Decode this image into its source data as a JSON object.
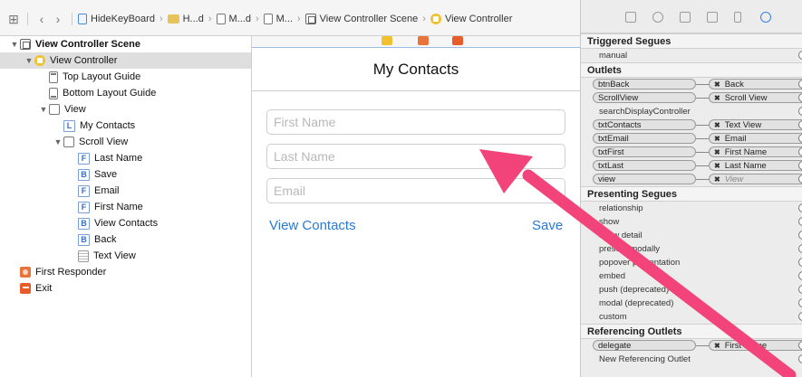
{
  "jumpbar": {
    "breadcrumbs": [
      "HideKeyBoard",
      "H...d",
      "M...d",
      "M...",
      "View Controller Scene",
      "View Controller"
    ]
  },
  "outline": {
    "items": [
      {
        "label": "View Controller Scene",
        "icon": "scene-icon",
        "depth": 0,
        "disclosure": "▼",
        "bold": true
      },
      {
        "label": "View Controller",
        "icon": "view-controller-icon",
        "depth": 1,
        "disclosure": "▼",
        "selected": true
      },
      {
        "label": "Top Layout Guide",
        "icon": "top-layout-guide-icon",
        "depth": 2
      },
      {
        "label": "Bottom Layout Guide",
        "icon": "bottom-layout-guide-icon",
        "depth": 2
      },
      {
        "label": "View",
        "icon": "view-icon",
        "depth": 2,
        "disclosure": "▼"
      },
      {
        "label": "My Contacts",
        "icon": "label-icon",
        "letter": "L",
        "depth": 3
      },
      {
        "label": "Scroll View",
        "icon": "scroll-view-icon",
        "depth": 3,
        "disclosure": "▼"
      },
      {
        "label": "Last Name",
        "icon": "text-field-icon",
        "letter": "F",
        "depth": 4
      },
      {
        "label": "Save",
        "icon": "button-icon",
        "letter": "B",
        "depth": 4
      },
      {
        "label": "Email",
        "icon": "text-field-icon",
        "letter": "F",
        "depth": 4
      },
      {
        "label": "First Name",
        "icon": "text-field-icon",
        "letter": "F",
        "depth": 4
      },
      {
        "label": "View Contacts",
        "icon": "button-icon",
        "letter": "B",
        "depth": 4
      },
      {
        "label": "Back",
        "icon": "button-icon",
        "letter": "B",
        "depth": 4
      },
      {
        "label": "Text View",
        "icon": "text-view-icon",
        "depth": 4
      },
      {
        "label": "First Responder",
        "icon": "first-responder-icon",
        "depth": 0
      },
      {
        "label": "Exit",
        "icon": "exit-icon",
        "depth": 0
      }
    ]
  },
  "canvas": {
    "nav_title": "My Contacts",
    "fields": [
      {
        "name": "first-name-field",
        "placeholder": "First Name"
      },
      {
        "name": "last-name-field",
        "placeholder": "Last Name"
      },
      {
        "name": "email-field",
        "placeholder": "Email"
      }
    ],
    "view_contacts_label": "View Contacts",
    "save_label": "Save"
  },
  "inspector": {
    "triggered_segues": {
      "title": "Triggered Segues",
      "rows": [
        "manual"
      ]
    },
    "outlets": {
      "title": "Outlets",
      "rows": [
        {
          "source": "btnBack",
          "target": "Back"
        },
        {
          "source": "ScrollView",
          "target": "Scroll View"
        },
        {
          "source": "searchDisplayController",
          "target": ""
        },
        {
          "source": "txtContacts",
          "target": "Text View"
        },
        {
          "source": "txtEmail",
          "target": "Email"
        },
        {
          "source": "txtFirst",
          "target": "First Name"
        },
        {
          "source": "txtLast",
          "target": "Last Name"
        },
        {
          "source": "view",
          "target": "View",
          "muted": true
        }
      ]
    },
    "presenting_segues": {
      "title": "Presenting Segues",
      "rows": [
        "relationship",
        "show",
        "show detail",
        "present modally",
        "popover presentation",
        "embed",
        "push (deprecated)",
        "modal (deprecated)",
        "custom"
      ]
    },
    "referencing_outlets": {
      "title": "Referencing Outlets",
      "rows": [
        {
          "source": "delegate",
          "target": "First Name"
        },
        {
          "source": "New Referencing Outlet",
          "target": ""
        }
      ]
    }
  },
  "colors": {
    "accent": "#2a7ad5",
    "annotation_arrow": "#f2447a",
    "selection": "#dedede"
  }
}
